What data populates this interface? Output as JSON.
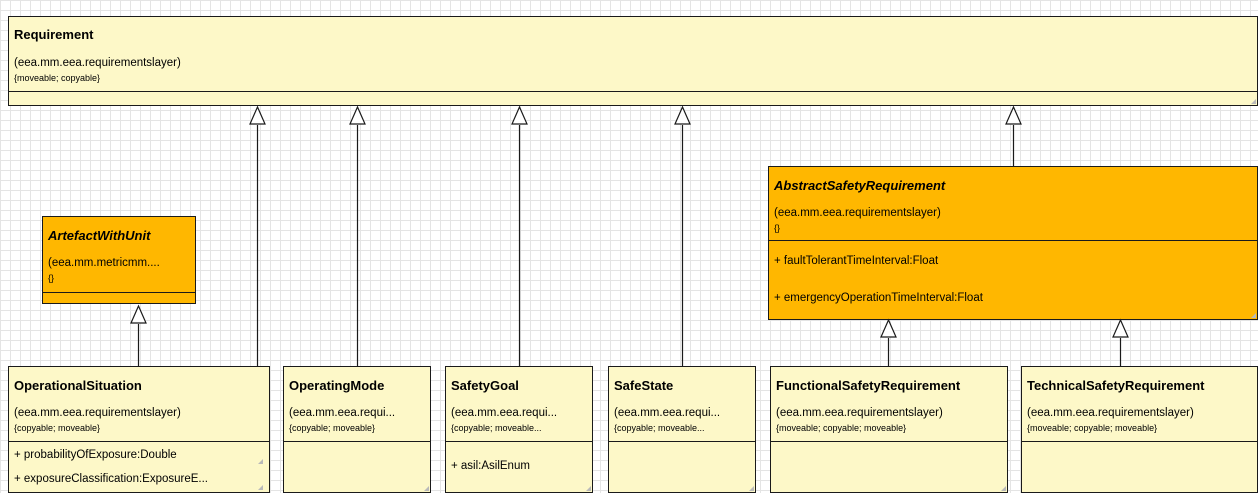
{
  "classes": {
    "requirement": {
      "name": "Requirement",
      "package": "(eea.mm.eea.requirementslayer)",
      "properties": "{moveable; copyable}",
      "attributes": []
    },
    "abstract_safety_requirement": {
      "name": "AbstractSafetyRequirement",
      "package": "(eea.mm.eea.requirementslayer)",
      "properties": "{}",
      "attributes": [
        "+ faultTolerantTimeInterval:Float",
        "+ emergencyOperationTimeInterval:Float"
      ]
    },
    "artefact_with_unit": {
      "name": "ArtefactWithUnit",
      "package": "(eea.mm.metricmm....",
      "properties": "{}",
      "attributes": []
    },
    "operational_situation": {
      "name": "OperationalSituation",
      "package": "(eea.mm.eea.requirementslayer)",
      "properties": "{copyable; moveable}",
      "attributes": [
        "+ probabilityOfExposure:Double",
        "+ exposureClassification:ExposureE..."
      ]
    },
    "operating_mode": {
      "name": "OperatingMode",
      "package": "(eea.mm.eea.requi...",
      "properties": "{copyable; moveable}",
      "attributes": []
    },
    "safety_goal": {
      "name": "SafetyGoal",
      "package": "(eea.mm.eea.requi...",
      "properties": "{copyable; moveable...",
      "attributes": [
        "+ asil:AsilEnum"
      ]
    },
    "safe_state": {
      "name": "SafeState",
      "package": "(eea.mm.eea.requi...",
      "properties": "{copyable; moveable...",
      "attributes": []
    },
    "functional_safety_requirement": {
      "name": "FunctionalSafetyRequirement",
      "package": "(eea.mm.eea.requirementslayer)",
      "properties": "{moveable; copyable; moveable}",
      "attributes": []
    },
    "technical_safety_requirement": {
      "name": "TechnicalSafetyRequirement",
      "package": "(eea.mm.eea.requirementslayer)",
      "properties": "{moveable; copyable; moveable}",
      "attributes": []
    }
  },
  "colors": {
    "concrete_fill": "#fdf8c8",
    "abstract_fill": "#ffb700",
    "border": "#1a1a1a",
    "grid": "#e4e4e4"
  }
}
